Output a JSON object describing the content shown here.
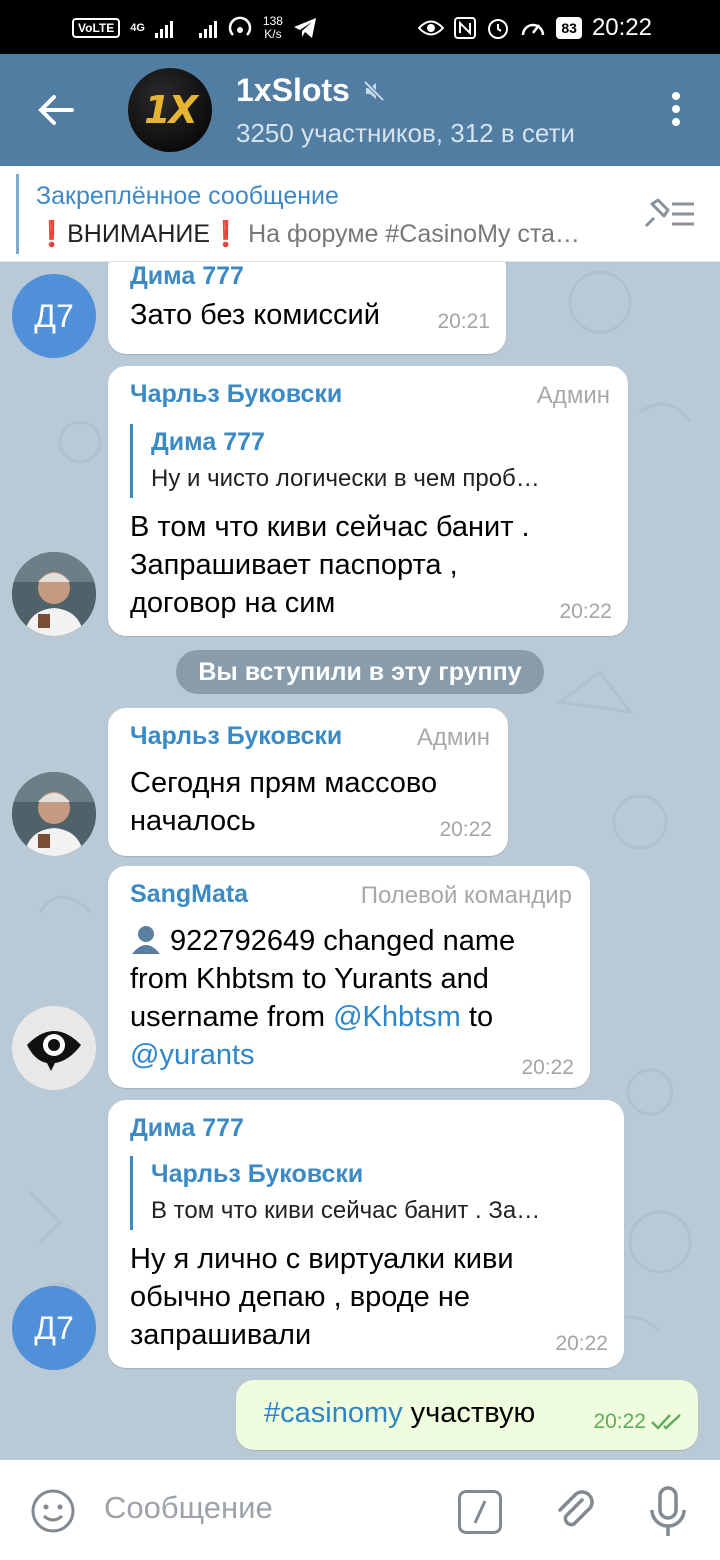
{
  "status_bar": {
    "network_label": "VoLTE",
    "network_type": "4G",
    "speed_value": "138",
    "speed_unit": "K/s",
    "battery": "83",
    "time": "20:22"
  },
  "header": {
    "avatar_text": "1X",
    "title": "1xSlots",
    "subtitle": "3250 участников, 312 в сети"
  },
  "pinned": {
    "title": "Закреплённое сообщение",
    "text_main": "❗ВНИМАНИЕ❗",
    "text_rest": " На форуме #CasinoMy ста…"
  },
  "messages": [
    {
      "avatar": "Д7",
      "sender": "Дима 777",
      "text": "Зато без комиссий",
      "time": "20:21"
    },
    {
      "sender": "Чарльз Буковски",
      "role": "Админ",
      "reply_name": "Дима 777",
      "reply_text": "Ну и чисто логически в чем проб…",
      "text_lines": [
        "В том что киви сейчас банит .",
        "Запрашивает паспорта ,",
        "договор на сим"
      ],
      "time": "20:22"
    },
    {
      "sender": "Чарльз Буковски",
      "role": "Админ",
      "text_lines": [
        "Сегодня прям массово",
        "началось"
      ],
      "time": "20:22"
    },
    {
      "sender": "SangMata",
      "role": "Полевой командир",
      "line1": " 922792649 changed name",
      "line2": "from Khbtsm to Yurants and",
      "line3_pre": "username from ",
      "line3_link": "@Khbtsm",
      "line3_post": " to",
      "line4_link": "@yurants",
      "time": "20:22"
    },
    {
      "avatar": "Д7",
      "sender": "Дима 777",
      "reply_name": "Чарльз Буковски",
      "reply_text": "В том что киви сейчас банит . За…",
      "text_lines": [
        "Ну я лично с виртуалки киви",
        "обычно депаю , вроде не",
        "запрашивали"
      ],
      "time": "20:22"
    }
  ],
  "service_message": "Вы вступили в эту группу",
  "outgoing": {
    "hashtag": "#casinomy",
    "text": " участвую",
    "time": "20:22"
  },
  "input": {
    "placeholder": "Сообщение"
  },
  "colors": {
    "header": "#517da2",
    "accent": "#3a8ac6",
    "outgoing_bubble": "#effdde",
    "chat_bg": "#b9c9d6"
  }
}
